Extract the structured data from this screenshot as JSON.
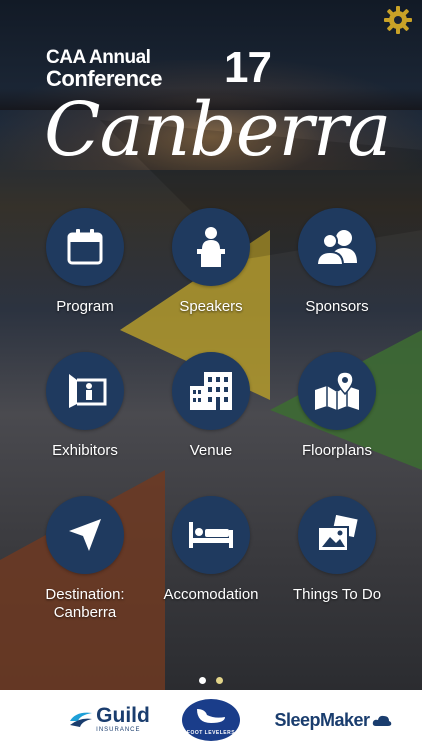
{
  "header": {
    "org": "CAA",
    "event_line1": "Annual",
    "event_line2": "Conference",
    "year": "17",
    "city": "Canberra"
  },
  "settings": {
    "icon": "gear-icon"
  },
  "menu": [
    {
      "label": "Program",
      "icon": "calendar-icon"
    },
    {
      "label": "Speakers",
      "icon": "podium-icon"
    },
    {
      "label": "Sponsors",
      "icon": "people-icon"
    },
    {
      "label": "Exhibitors",
      "icon": "booth-icon"
    },
    {
      "label": "Venue",
      "icon": "building-icon"
    },
    {
      "label": "Floorplans",
      "icon": "map-pin-icon"
    },
    {
      "label": "Destination:\nCanberra",
      "icon": "navigation-arrow-icon"
    },
    {
      "label": "Accomodation",
      "icon": "bed-icon"
    },
    {
      "label": "Things To Do",
      "icon": "photos-icon"
    }
  ],
  "pager": {
    "pages": 2,
    "active": 1
  },
  "sponsors": [
    {
      "name": "Guild",
      "sub": "INSURANCE"
    },
    {
      "name": "",
      "sub": "FOOT LEVELERS"
    },
    {
      "name": "SleepMaker",
      "sub": ""
    }
  ],
  "colors": {
    "circle": "#1f3a5f",
    "gear": "#c9a227",
    "yellow_tri": "#b39a2c",
    "green_tri": "#3d6a33",
    "brown_tri": "#6e3a22"
  }
}
